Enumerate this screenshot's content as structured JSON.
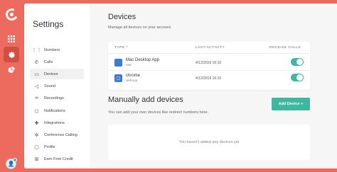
{
  "rail": {
    "icons": [
      "logo-icon",
      "apps-icon",
      "gear-icon",
      "pie-chart-icon"
    ]
  },
  "sidebar": {
    "title": "Settings",
    "items": [
      {
        "label": "Numbers",
        "icon": "grid-icon"
      },
      {
        "label": "Calls",
        "icon": "phone-icon"
      },
      {
        "label": "Devices",
        "icon": "monitor-icon",
        "active": true
      },
      {
        "label": "Sound",
        "icon": "speaker-icon"
      },
      {
        "label": "Recordings",
        "icon": "voicemail-icon"
      },
      {
        "label": "Notifications",
        "icon": "bell-icon"
      },
      {
        "label": "Integrations",
        "icon": "puzzle-icon"
      },
      {
        "label": "Conference Calling",
        "icon": "conference-icon"
      },
      {
        "label": "Profile",
        "icon": "user-icon"
      },
      {
        "label": "Earn Free Credit",
        "icon": "gift-icon"
      }
    ]
  },
  "devices": {
    "heading": "Devices",
    "subtitle": "Manage all devices on your account.",
    "columns": {
      "type": "TYPE",
      "last_activity": "LAST ACTIVITY",
      "receive_calls": "RECEIVE CALLS"
    },
    "sort_indicator": "^",
    "rows": [
      {
        "name": "Mac Desktop App",
        "kind": "Mac",
        "last_activity": "4/12/2019 16:10",
        "receive_calls": true
      },
      {
        "name": "chrome",
        "kind": "webApp",
        "last_activity": "4/12/2019 16:10",
        "receive_calls": true
      }
    ]
  },
  "manual": {
    "heading": "Manually add devices",
    "subtitle": "You can add your own devices like redirect numbers here.",
    "add_button": "Add Device +",
    "empty_text": "You haven't added any devices yet"
  },
  "colors": {
    "brand": "#ec6b5e",
    "accent": "#3bb89e",
    "device_icon": "#3a7bd5"
  }
}
